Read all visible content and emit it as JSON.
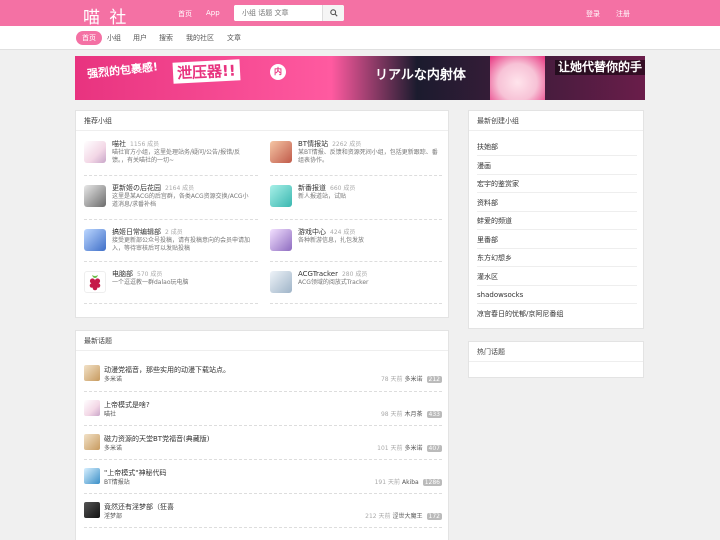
{
  "header": {
    "logo": "喵 社",
    "nav": [
      "首页",
      "App"
    ],
    "search_placeholder": "小组 话题 文章",
    "login": "登录",
    "register": "注册"
  },
  "subnav": [
    "首页",
    "小组",
    "用户",
    "搜索",
    "我的社区",
    "文章"
  ],
  "banner": {
    "t1": "强烈的包裹感!",
    "t2": "泄压器!!",
    "t3": "内",
    "t4": "リアルな内射体",
    "t5": "让她代替你的手"
  },
  "recommended": {
    "title": "推荐小组",
    "groups": [
      {
        "name": "喵社",
        "count": "1156 成员",
        "desc": "喵社官方小组，这里处理站务/疑问/公告/报错/反馈。，有关喵社的一切~"
      },
      {
        "name": "BT情报站",
        "count": "2262 成员",
        "desc": "某BT情报、反馈和资源死间小组，包括更新跟踪、番组表协作。"
      },
      {
        "name": "更新姬の后花园",
        "count": "2164 成员",
        "desc": "这里是某ACG的后宫群，各类ACG资源交换/ACG小道消息/求番补档"
      },
      {
        "name": "新番报道",
        "count": "660 成员",
        "desc": "新人报道站，试贴"
      },
      {
        "name": "搞姬日常编辑部",
        "count": "2 成员",
        "desc": "接受更新部公众号投稿，请有投稿意向的会员申请加入，等待审核后可以发贴投稿"
      },
      {
        "name": "游戏中心",
        "count": "424 成员",
        "desc": "各种新游信息，扎包发放"
      },
      {
        "name": "电脑部",
        "count": "570 成员",
        "desc": "一个逗逗教一群dalao玩电脑"
      },
      {
        "name": "ACGTracker",
        "count": "280 成员",
        "desc": "ACG领域的阅放式Tracker"
      }
    ]
  },
  "latest_created": {
    "title": "最新创建小组",
    "items": [
      "扶她部",
      "漫画",
      "宏宇的鉴赏家",
      "资料部",
      "蚌爱的频道",
      "里番部",
      "东方幻想乡",
      "灌水区",
      "shadowsocks",
      "凉宫春日的忧郁/京阿尼番组"
    ]
  },
  "hot_topics": {
    "title": "热门话题"
  },
  "latest_topics": {
    "title": "最新话题",
    "topics": [
      {
        "title": "动漫党福音，那些实用的动漫下载站点。",
        "group": "多米诺",
        "days": "78 天前",
        "user": "多米诺",
        "replies": "212"
      },
      {
        "title": "上帝模式是啥?",
        "group": "喵社",
        "days": "98 天前",
        "user": "木月茶",
        "replies": "433"
      },
      {
        "title": "磁力资源的天堂BT党福音(典藏版)",
        "group": "多米诺",
        "days": "101 天前",
        "user": "多米诺",
        "replies": "407"
      },
      {
        "title": "\"上帝模式\"神秘代码",
        "group": "BT情报站",
        "days": "191 天前",
        "user": "Akiba",
        "replies": "1286"
      },
      {
        "title": "竟然还有淫梦部（狂喜",
        "group": "淫梦部",
        "days": "212 天前",
        "user": "涩世大魔王",
        "replies": "172"
      }
    ]
  },
  "colors": {
    "brand": "#f471a4"
  }
}
